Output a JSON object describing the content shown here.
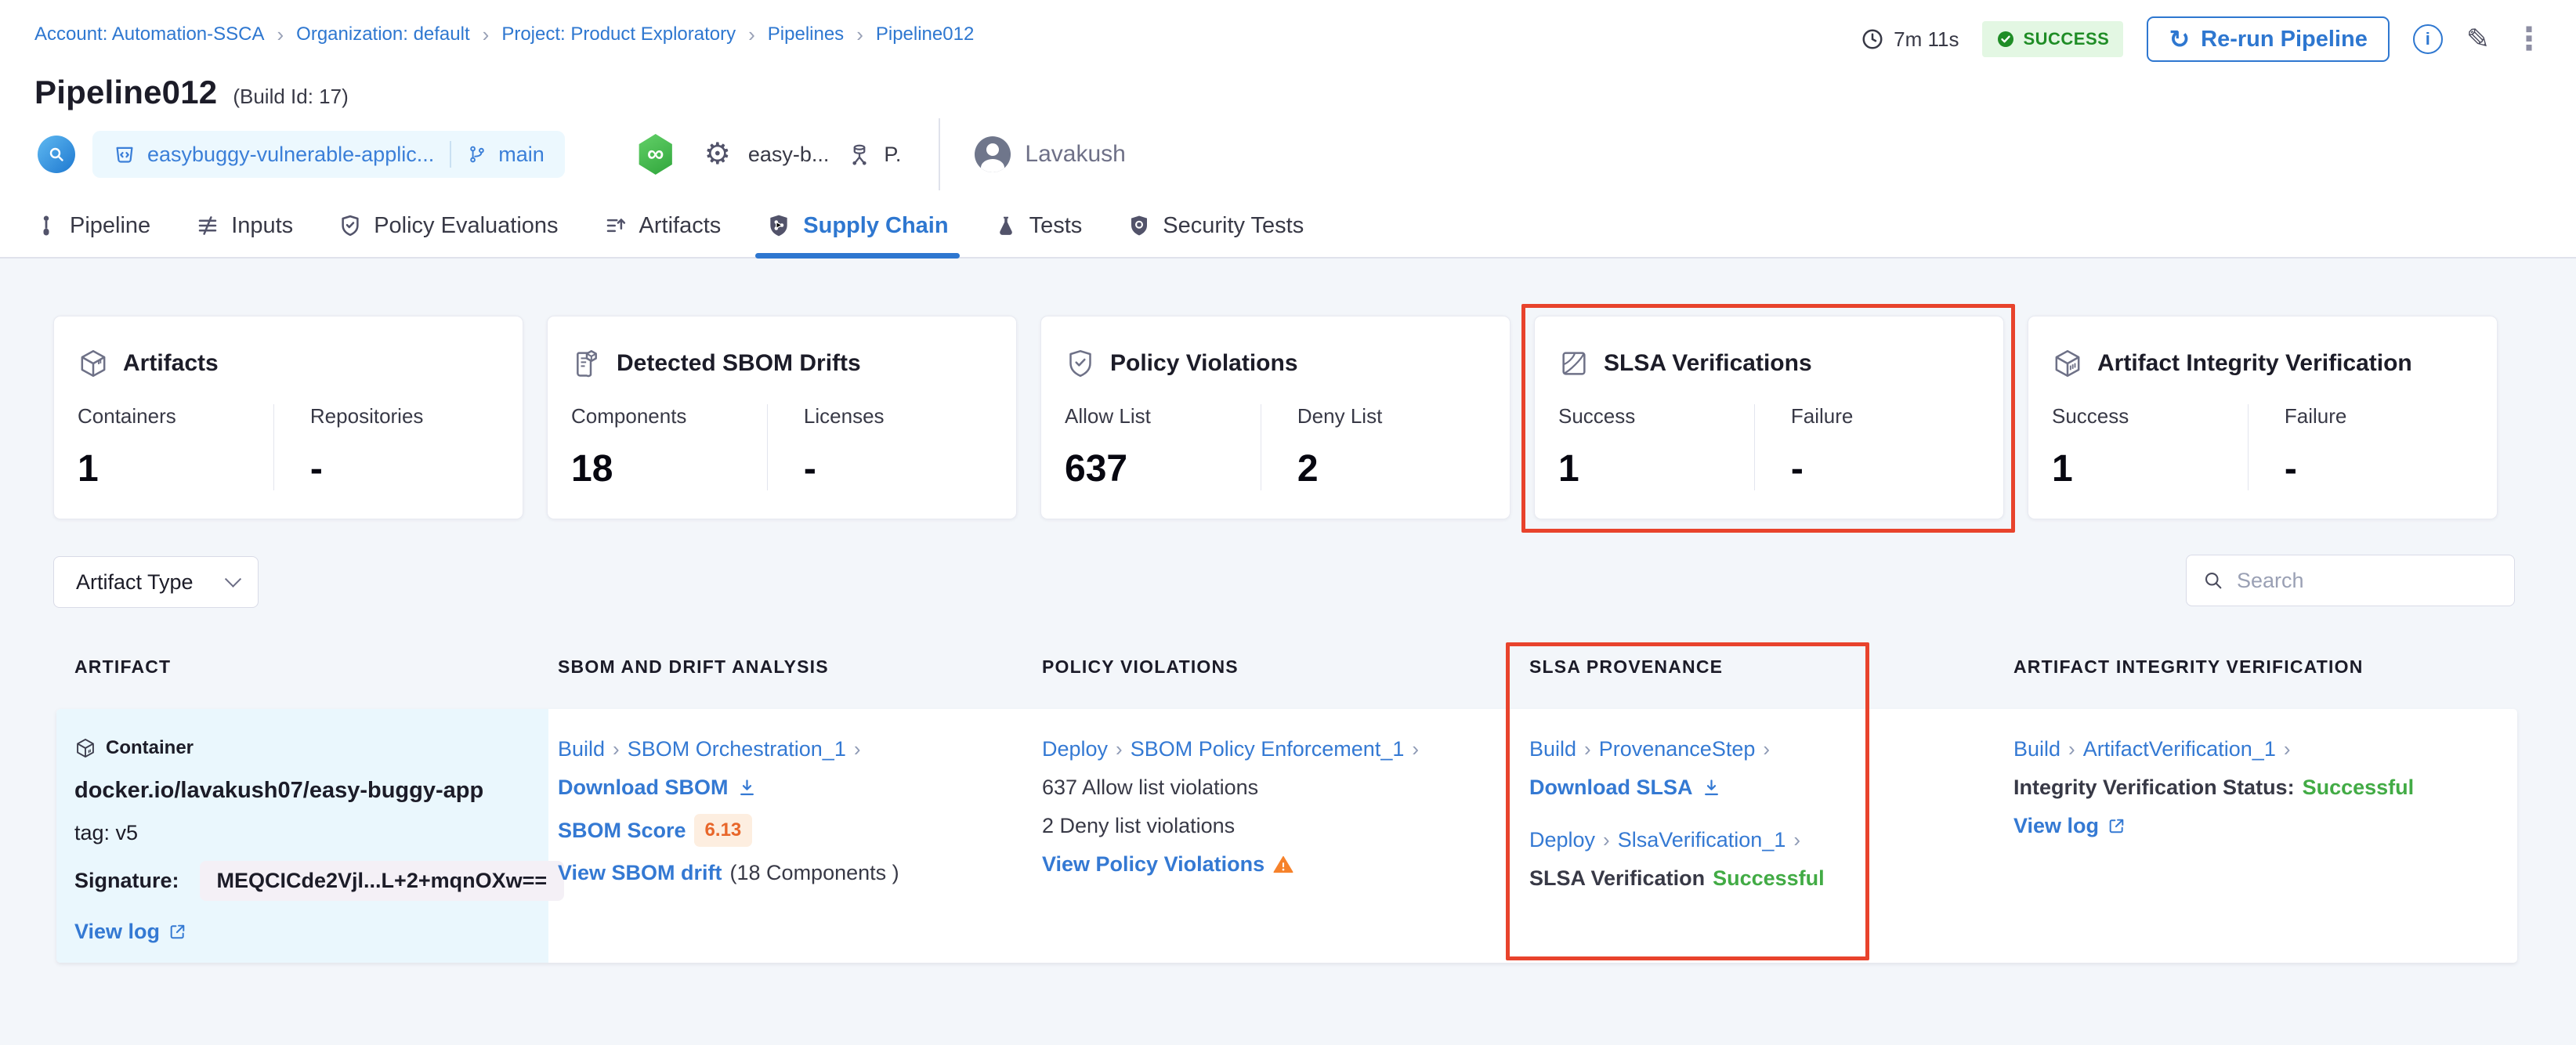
{
  "breadcrumb": {
    "items": [
      "Account: Automation-SSCA",
      "Organization: default",
      "Project: Product Exploratory",
      "Pipelines",
      "Pipeline012"
    ]
  },
  "header": {
    "duration": "7m 11s",
    "status_badge": "SUCCESS",
    "rerun_button": "Re-run Pipeline",
    "title": "Pipeline012",
    "build_id": "(Build Id: 17)",
    "repo_name": "easybuggy-vulnerable-applic...",
    "branch_name": "main",
    "trigger_name": "easy-b...",
    "trigger_short": "P.",
    "user_name": "Lavakush"
  },
  "icons": {
    "info": "i",
    "refresh": "↻",
    "pencil": "✎",
    "kebab": "⋮",
    "gear": "⚙",
    "infinity": "∞",
    "breadcrumb_separator": "›",
    "link_separator": "›"
  },
  "tabs": [
    {
      "label": "Pipeline"
    },
    {
      "label": "Inputs"
    },
    {
      "label": "Policy Evaluations"
    },
    {
      "label": "Artifacts"
    },
    {
      "label": "Supply Chain"
    },
    {
      "label": "Tests"
    },
    {
      "label": "Security Tests"
    }
  ],
  "summary_cards": [
    {
      "title": "Artifacts",
      "col1_label": "Containers",
      "col1_value": "1",
      "col2_label": "Repositories",
      "col2_value": "-"
    },
    {
      "title": "Detected SBOM Drifts",
      "col1_label": "Components",
      "col1_value": "18",
      "col2_label": "Licenses",
      "col2_value": "-"
    },
    {
      "title": "Policy Violations",
      "col1_label": "Allow List",
      "col1_value": "637",
      "col2_label": "Deny List",
      "col2_value": "2"
    },
    {
      "title": "SLSA Verifications",
      "col1_label": "Success",
      "col1_value": "1",
      "col2_label": "Failure",
      "col2_value": "-"
    },
    {
      "title": "Artifact Integrity Verification",
      "col1_label": "Success",
      "col1_value": "1",
      "col2_label": "Failure",
      "col2_value": "-"
    }
  ],
  "filters": {
    "artifact_type": "Artifact Type",
    "search_placeholder": "Search"
  },
  "table": {
    "headers": [
      "ARTIFACT",
      "SBOM AND DRIFT ANALYSIS",
      "POLICY VIOLATIONS",
      "SLSA PROVENANCE",
      "ARTIFACT INTEGRITY VERIFICATION"
    ],
    "row": {
      "artifact": {
        "type": "Container",
        "image": "docker.io/lavakush07/easy-buggy-app",
        "tag": "tag: v5",
        "signature_label": "Signature:",
        "signature_value": "MEQCICde2Vjl...L+2+mqnOXw==",
        "view_log": "View log"
      },
      "sbom": {
        "stage": "Build",
        "step": "SBOM Orchestration_1",
        "download": "Download SBOM",
        "score_label": "SBOM Score",
        "score": "6.13",
        "drift_link": "View SBOM drift",
        "drift_meta": "(18 Components )"
      },
      "policy": {
        "stage": "Deploy",
        "step": "SBOM Policy Enforcement_1",
        "allow": "637 Allow list violations",
        "deny": "2 Deny list violations",
        "view": "View Policy Violations"
      },
      "slsa": {
        "stage1": "Build",
        "step1": "ProvenanceStep",
        "download": "Download SLSA",
        "stage2": "Deploy",
        "step2": "SlsaVerification_1",
        "verification_label": "SLSA Verification",
        "verification_status": "Successful"
      },
      "integrity": {
        "stage": "Build",
        "step": "ArtifactVerification_1",
        "status_label": "Integrity Verification Status:",
        "status_value": "Successful",
        "view_log": "View log"
      }
    }
  },
  "colors": {
    "accent_blue": "#2e77d0",
    "annotation_red": "#e8432c",
    "success_green": "#42ab45",
    "status_badge_bg": "#e3f7e3",
    "status_badge_text": "#1f8d26",
    "score_orange": "#e8662a",
    "warning_orange": "#f6822b",
    "artifact_cell_bg": "#eaf7fd"
  }
}
